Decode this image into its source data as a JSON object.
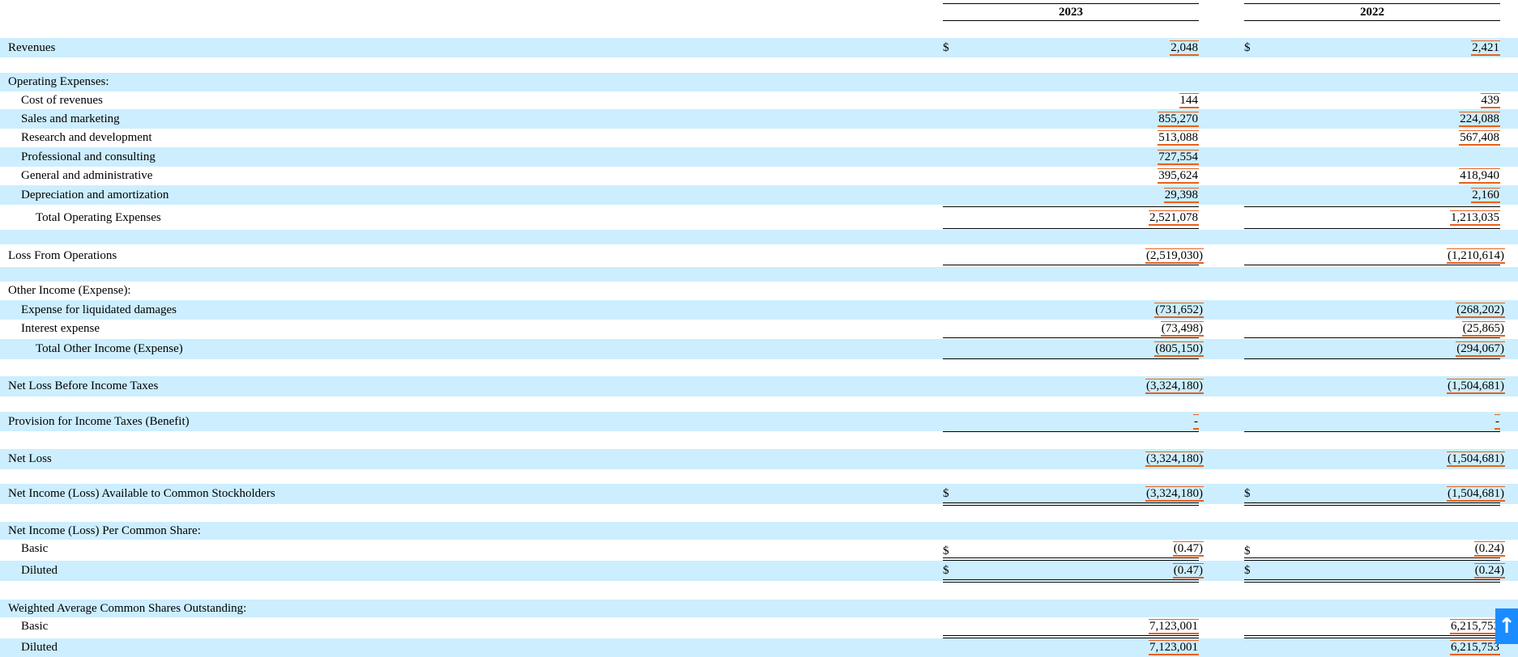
{
  "header": {
    "year_1": "2023",
    "year_2": "2022"
  },
  "currency_symbol": "$",
  "rows": {
    "revenues": {
      "label": "Revenues",
      "v2023": "2,048",
      "v2022": "2,421"
    },
    "operating_expenses": {
      "label": "Operating Expenses:"
    },
    "cost_of_revenues": {
      "label": "Cost of revenues",
      "v2023": "144",
      "v2022": "439"
    },
    "sales_marketing": {
      "label": "Sales and marketing",
      "v2023": "855,270",
      "v2022": "224,088"
    },
    "research_development": {
      "label": "Research and development",
      "v2023": "513,088",
      "v2022": "567,408"
    },
    "professional_consulting": {
      "label": "Professional and consulting",
      "v2023": "727,554",
      "v2022": ""
    },
    "general_admin": {
      "label": "General and administrative",
      "v2023": "395,624",
      "v2022": "418,940"
    },
    "depreciation": {
      "label": "Depreciation and amortization",
      "v2023": "29,398",
      "v2022": "2,160"
    },
    "total_operating_expenses": {
      "label": "Total Operating Expenses",
      "v2023": "2,521,078",
      "v2022": "1,213,035"
    },
    "loss_from_operations": {
      "label": "Loss From Operations",
      "v2023": "(2,519,030)",
      "v2022": "(1,210,614)"
    },
    "other_income": {
      "label": "Other Income (Expense):"
    },
    "liquidated_damages": {
      "label": "Expense for liquidated damages",
      "v2023": "(731,652)",
      "v2022": "(268,202)"
    },
    "interest_expense": {
      "label": "Interest expense",
      "v2023": "(73,498)",
      "v2022": "(25,865)"
    },
    "total_other_income": {
      "label": "Total Other Income (Expense)",
      "v2023": "(805,150)",
      "v2022": "(294,067)"
    },
    "net_loss_before_taxes": {
      "label": "Net Loss Before Income Taxes",
      "v2023": "(3,324,180)",
      "v2022": "(1,504,681)"
    },
    "provision_income_taxes": {
      "label": "Provision for Income Taxes (Benefit)",
      "v2023": "-",
      "v2022": "-"
    },
    "net_loss": {
      "label": "Net Loss",
      "v2023": "(3,324,180)",
      "v2022": "(1,504,681)"
    },
    "net_income_available": {
      "label": "Net Income (Loss) Available to Common Stockholders",
      "v2023": "(3,324,180)",
      "v2022": "(1,504,681)"
    },
    "per_share": {
      "label": "Net Income (Loss) Per Common Share:"
    },
    "per_share_basic": {
      "label": "Basic",
      "v2023": "(0.47)",
      "v2022": "(0.24)"
    },
    "per_share_diluted": {
      "label": "Diluted",
      "v2023": "(0.47)",
      "v2022": "(0.24)"
    },
    "weighted_avg": {
      "label": "Weighted Average Common Shares Outstanding:"
    },
    "weighted_basic": {
      "label": "Basic",
      "v2023": "7,123,001",
      "v2022": "6,215,753"
    },
    "weighted_diluted": {
      "label": "Diluted",
      "v2023": "7,123,001",
      "v2022": "6,215,753"
    }
  },
  "scroll_top_icon": "arrow-up-icon",
  "colors": {
    "band": "#cceeff",
    "highlight": "#e8601c",
    "scroll_button": "#1a8cff"
  }
}
